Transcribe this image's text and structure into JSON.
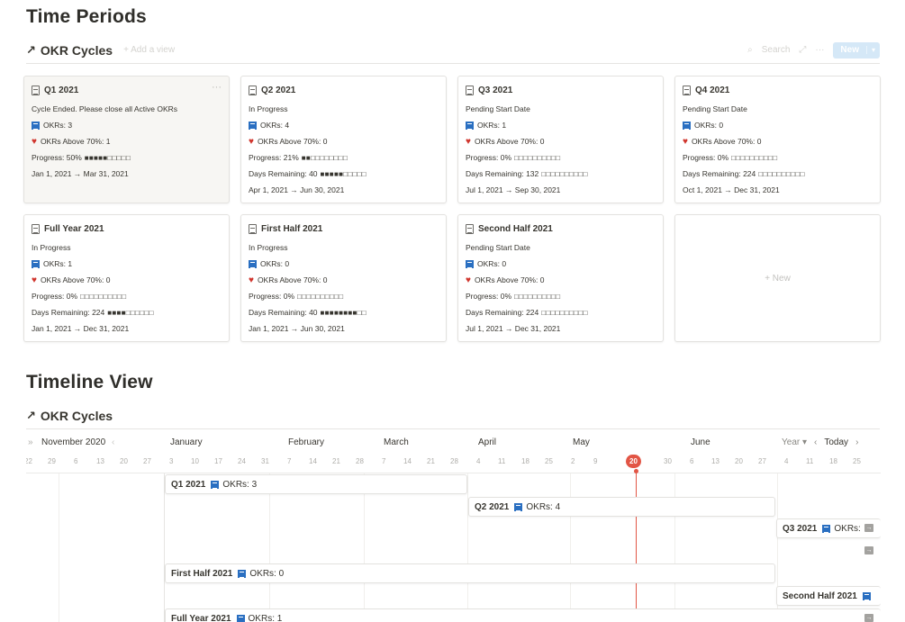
{
  "sections": {
    "time_periods": "Time Periods",
    "timeline_view": "Timeline View"
  },
  "gallery": {
    "title": "OKR Cycles",
    "add_view": "+ Add a view",
    "search": "Search",
    "new_button": "New",
    "new_card_label": "+ New",
    "cards": [
      {
        "title": "Q1 2021",
        "status": "Cycle Ended. Please close all Active OKRs",
        "okrs": "OKRs: 3",
        "above": "OKRs Above 70%: 1",
        "third": "Progress: 50%",
        "third_bar": "■■■■■□□□□□",
        "dates": "Jan 1, 2021 → Mar 31, 2021"
      },
      {
        "title": "Q2 2021",
        "status": "In Progress",
        "okrs": "OKRs: 4",
        "above": "OKRs Above 70%: 0",
        "third": "Progress: 21%",
        "third_bar": "■■□□□□□□□□",
        "fourth": "Days Remaining: 40",
        "fourth_bar": "■■■■■□□□□□",
        "dates": "Apr 1, 2021 → Jun 30, 2021"
      },
      {
        "title": "Q3 2021",
        "status": "Pending Start Date",
        "okrs": "OKRs: 1",
        "above": "OKRs Above 70%: 0",
        "third": "Progress: 0%",
        "third_bar": "□□□□□□□□□□",
        "fourth": "Days Remaining: 132",
        "fourth_bar": "□□□□□□□□□□",
        "dates": "Jul 1, 2021 → Sep 30, 2021"
      },
      {
        "title": "Q4 2021",
        "status": "Pending Start Date",
        "okrs": "OKRs: 0",
        "above": "OKRs Above 70%: 0",
        "third": "Progress: 0%",
        "third_bar": "□□□□□□□□□□",
        "fourth": "Days Remaining: 224",
        "fourth_bar": "□□□□□□□□□□",
        "dates": "Oct 1, 2021 → Dec 31, 2021"
      },
      {
        "title": "Full Year 2021",
        "status": "In Progress",
        "okrs": "OKRs: 1",
        "above": "OKRs Above 70%: 0",
        "third": "Progress: 0%",
        "third_bar": "□□□□□□□□□□",
        "fourth": "Days Remaining: 224",
        "fourth_bar": "■■■■□□□□□□",
        "dates": "Jan 1, 2021 → Dec 31, 2021"
      },
      {
        "title": "First Half 2021",
        "status": "In Progress",
        "okrs": "OKRs: 0",
        "above": "OKRs Above 70%: 0",
        "third": "Progress: 0%",
        "third_bar": "□□□□□□□□□□",
        "fourth": "Days Remaining: 40",
        "fourth_bar": "■■■■■■■■□□",
        "dates": "Jan 1, 2021 → Jun 30, 2021"
      },
      {
        "title": "Second Half 2021",
        "status": "Pending Start Date",
        "okrs": "OKRs: 0",
        "above": "OKRs Above 70%: 0",
        "third": "Progress: 0%",
        "third_bar": "□□□□□□□□□□",
        "fourth": "Days Remaining: 224",
        "fourth_bar": "□□□□□□□□□□",
        "dates": "Jul 1, 2021 → Dec 31, 2021"
      }
    ]
  },
  "timeline": {
    "title": "OKR Cycles",
    "start_month": "November 2020",
    "months": [
      "January",
      "February",
      "March",
      "April",
      "May",
      "June"
    ],
    "ticks": [
      "22",
      "29",
      "6",
      "13",
      "20",
      "27",
      "3",
      "10",
      "17",
      "24",
      "31",
      "7",
      "14",
      "21",
      "28",
      "7",
      "14",
      "21",
      "28",
      "4",
      "11",
      "18",
      "25",
      "2",
      "9",
      "30",
      "6",
      "13",
      "20",
      "27",
      "4",
      "11",
      "18",
      "25"
    ],
    "today_day": "20",
    "zoom": "Year",
    "today_label": "Today",
    "items": [
      {
        "title": "Q1 2021",
        "okrs": "OKRs: 3"
      },
      {
        "title": "Q2 2021",
        "okrs": "OKRs: 4"
      },
      {
        "title": "Q3 2021",
        "okrs": "OKRs:"
      },
      {
        "title": "First Half 2021",
        "okrs": "OKRs: 0"
      },
      {
        "title": "Second Half 2021",
        "okrs": ""
      },
      {
        "title": "Full Year 2021",
        "okrs": "OKRs: 1"
      }
    ]
  },
  "colors": {
    "accent_blue": "#2a6fc1",
    "heart_red": "#d0342c",
    "today_red": "#e25545"
  }
}
